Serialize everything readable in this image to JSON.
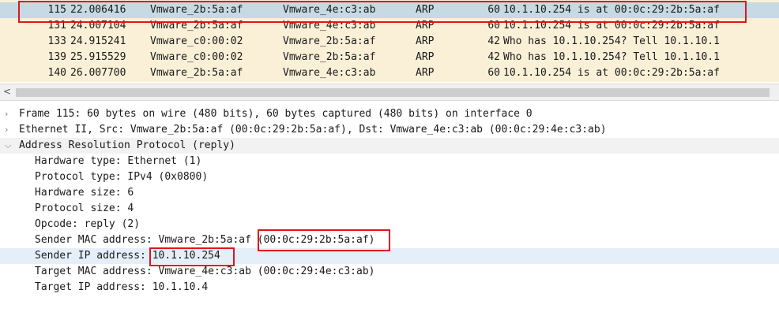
{
  "packets": [
    {
      "no": "115",
      "time": "22.006416",
      "src": "Vmware_2b:5a:af",
      "dst": "Vmware_4e:c3:ab",
      "proto": "ARP",
      "len": "60",
      "info": "10.1.10.254 is at 00:0c:29:2b:5a:af"
    },
    {
      "no": "131",
      "time": "24.007104",
      "src": "Vmware_2b:5a:af",
      "dst": "Vmware_4e:c3:ab",
      "proto": "ARP",
      "len": "60",
      "info": "10.1.10.254 is at 00:0c:29:2b:5a:af"
    },
    {
      "no": "133",
      "time": "24.915241",
      "src": "Vmware_c0:00:02",
      "dst": "Vmware_2b:5a:af",
      "proto": "ARP",
      "len": "42",
      "info": "Who has 10.1.10.254? Tell 10.1.10.1"
    },
    {
      "no": "139",
      "time": "25.915529",
      "src": "Vmware_c0:00:02",
      "dst": "Vmware_2b:5a:af",
      "proto": "ARP",
      "len": "42",
      "info": "Who has 10.1.10.254? Tell 10.1.10.1"
    },
    {
      "no": "140",
      "time": "26.007700",
      "src": "Vmware_2b:5a:af",
      "dst": "Vmware_4e:c3:ab",
      "proto": "ARP",
      "len": "60",
      "info": "10.1.10.254 is at 00:0c:29:2b:5a:af"
    }
  ],
  "scroll_arrow": "<",
  "details": {
    "frame": "Frame 115: 60 bytes on wire (480 bits), 60 bytes captured (480 bits) on interface 0",
    "ethernet": "Ethernet II, Src: Vmware_2b:5a:af (00:0c:29:2b:5a:af), Dst: Vmware_4e:c3:ab (00:0c:29:4e:c3:ab)",
    "arp": "Address Resolution Protocol (reply)",
    "fields": {
      "hw_type": "Hardware type: Ethernet (1)",
      "proto_type": "Protocol type: IPv4 (0x0800)",
      "hw_size": "Hardware size: 6",
      "proto_size": "Protocol size: 4",
      "opcode": "Opcode: reply (2)",
      "sender_mac": "Sender MAC address: Vmware_2b:5a:af (00:0c:29:2b:5a:af)",
      "sender_ip": "Sender IP address: 10.1.10.254",
      "target_mac": "Target MAC address: Vmware_4e:c3:ab (00:0c:29:4e:c3:ab)",
      "target_ip": "Target IP address: 10.1.10.4"
    }
  },
  "icons": {
    "collapsed": "chevron-right-icon",
    "expanded": "chevron-down-icon"
  },
  "colors": {
    "selected_row": "#c6d9e5",
    "list_bg": "#faf0d7",
    "highlight_box": "#e0161c",
    "detail_highlight": "#e5eff9"
  }
}
